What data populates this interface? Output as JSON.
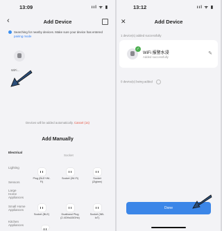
{
  "screen1": {
    "status": {
      "time": "13:09",
      "icons": "ııl ᯤ ▮"
    },
    "nav": {
      "title": "Add Device"
    },
    "tip": {
      "text": "Searching for nearby devices. Make sure your device has entered",
      "link": "pairing mode"
    },
    "found_device": {
      "label": "WiFi..."
    },
    "auto_add": {
      "text": "Devices will be added automatically.",
      "cancel": "Cancel (1s)"
    },
    "manual_title": "Add Manually",
    "categories": [
      "Electrical",
      "Lighting",
      "Sensors",
      "Large Home Appliances",
      "Small Home Appliances",
      "Kitchen Appliances"
    ],
    "section_label": "Socket",
    "tiles": [
      {
        "label": "Plug (BLE+Wi-Fi)"
      },
      {
        "label": "Socket (Wi-Fi)"
      },
      {
        "label": "Socket (Zigbee)"
      },
      {
        "label": "Socket (BLE)"
      },
      {
        "label": "Dualband Plug (2.4GHz&5GHz)"
      },
      {
        "label": "Socket (NB-IoT)"
      }
    ]
  },
  "screen2": {
    "status": {
      "time": "13:12",
      "icons": "ııl ᯤ ▮"
    },
    "nav": {
      "title": "Add Device"
    },
    "added_section": "1 device(s) added successfully",
    "device": {
      "name": "WiFi 报警水浸",
      "status": "Added successfully"
    },
    "adding_section": "0 device(s) being added",
    "done_label": "Done"
  },
  "colors": {
    "accent": "#3b86e8",
    "cancel": "#e3503c",
    "success": "#4caf50"
  }
}
